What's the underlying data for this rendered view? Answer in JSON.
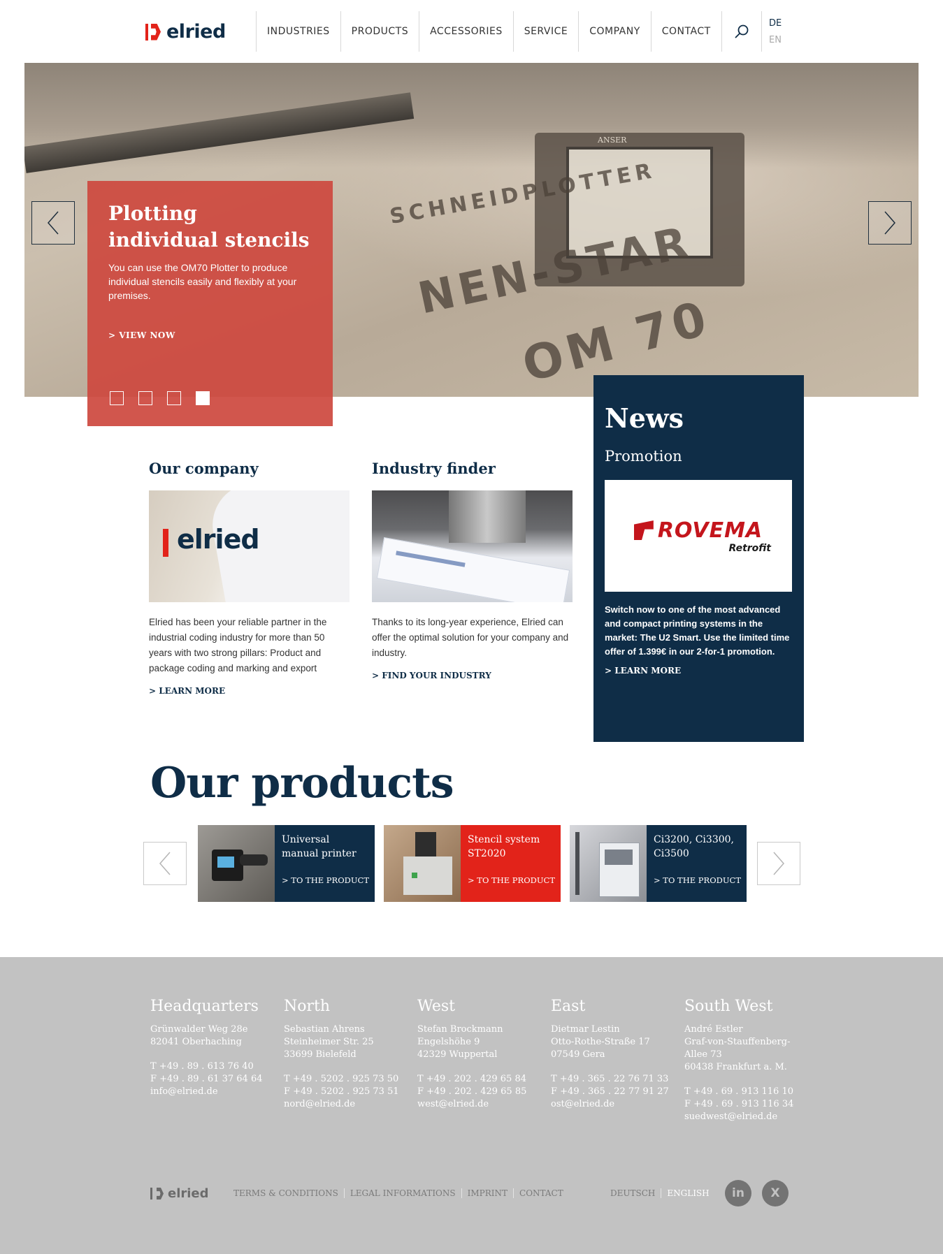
{
  "brand": {
    "logo_text": "elried",
    "accent": "#e2231a",
    "navy": "#0f2d47"
  },
  "nav": {
    "items": [
      "INDUSTRIES",
      "PRODUCTS",
      "ACCESSORIES",
      "SERVICE",
      "COMPANY",
      "CONTACT"
    ],
    "search_icon": "search-icon",
    "languages": {
      "de": "DE",
      "en": "EN"
    }
  },
  "hero": {
    "stencil_texts": [
      "SCHNEIDPLOTTER",
      "NEN-STAR",
      "OM 70"
    ],
    "device_label": "ANSER",
    "slide": {
      "title": "Plotting individual stencils",
      "text": "You can use the OM70 Plotter to produce individual stencils easily and flexibly at your premises.",
      "link": "> VIEW NOW"
    },
    "dots": [
      false,
      false,
      false,
      true
    ]
  },
  "company": {
    "title": "Our company",
    "text": "Elried has been your reliable partner in the industrial coding industry for more than 50 years with two strong pillars: Product and package coding and marking and export",
    "link": "> LEARN MORE"
  },
  "industry": {
    "title": "Industry finder",
    "text": "Thanks to its long-year experience, Elried can offer the optimal solution for your company and industry.",
    "link": "> FIND YOUR INDUSTRY"
  },
  "news": {
    "title": "News",
    "subtitle": "Promotion",
    "logo_text": "ROVEMA",
    "logo_sub": "Retrofit",
    "text": "Switch now to one of the most advanced and compact printing systems in the market: The U2 Smart. Use the limited time offer of 1.399€ in our 2-for-1 promotion.",
    "link": "> LEARN MORE"
  },
  "products": {
    "title": "Our products",
    "items": [
      {
        "name": "Universal manual printer",
        "link": "> TO THE PRODUCT",
        "color": "#0f2d47"
      },
      {
        "name": "Stencil system ST2020",
        "link": "> TO THE PRODUCT",
        "color": "#e2231a"
      },
      {
        "name": "Ci3200, Ci3300, Ci3500",
        "link": "> TO THE PRODUCT",
        "color": "#0f2d47"
      }
    ]
  },
  "footer": {
    "columns": [
      {
        "title": "Headquarters",
        "address": [
          "Grünwalder Weg 28e",
          "82041 Oberhaching"
        ],
        "contact": [
          "T +49 . 89 . 613 76 40",
          "F +49 . 89 . 61 37 64 64",
          "info@elried.de"
        ]
      },
      {
        "title": "North",
        "address": [
          "Sebastian Ahrens",
          "Steinheimer Str. 25",
          "33699 Bielefeld"
        ],
        "contact": [
          "T +49 . 5202 . 925 73 50",
          "F +49 . 5202 . 925 73 51",
          "nord@elried.de"
        ]
      },
      {
        "title": "West",
        "address": [
          "Stefan Brockmann",
          "Engelshöhe 9",
          "42329 Wuppertal"
        ],
        "contact": [
          "T +49 . 202 . 429 65 84",
          "F +49 . 202 . 429 65 85",
          "west@elried.de"
        ]
      },
      {
        "title": "East",
        "address": [
          "Dietmar Lestin",
          "Otto-Rothe-Straße 17",
          "07549 Gera"
        ],
        "contact": [
          "T +49 . 365 . 22 76 71 33",
          "F +49 . 365 . 22 77 91 27",
          "ost@elried.de"
        ]
      },
      {
        "title": "South West",
        "address": [
          "André Estler",
          "Graf-von-Stauffenberg-",
          "Allee 73",
          "60438 Frankfurt a. M."
        ],
        "contact": [
          "T +49 . 69 . 913 116 10",
          "F +49 . 69 . 913 116 34",
          "suedwest@elried.de"
        ]
      }
    ],
    "links": [
      "TERMS & CONDITIONS",
      "LEGAL INFORMATIONS",
      "IMPRINT",
      "CONTACT"
    ],
    "languages": {
      "de": "DEUTSCH",
      "en": "ENGLISH"
    },
    "social": {
      "linkedin": "in",
      "xing": "X"
    }
  }
}
